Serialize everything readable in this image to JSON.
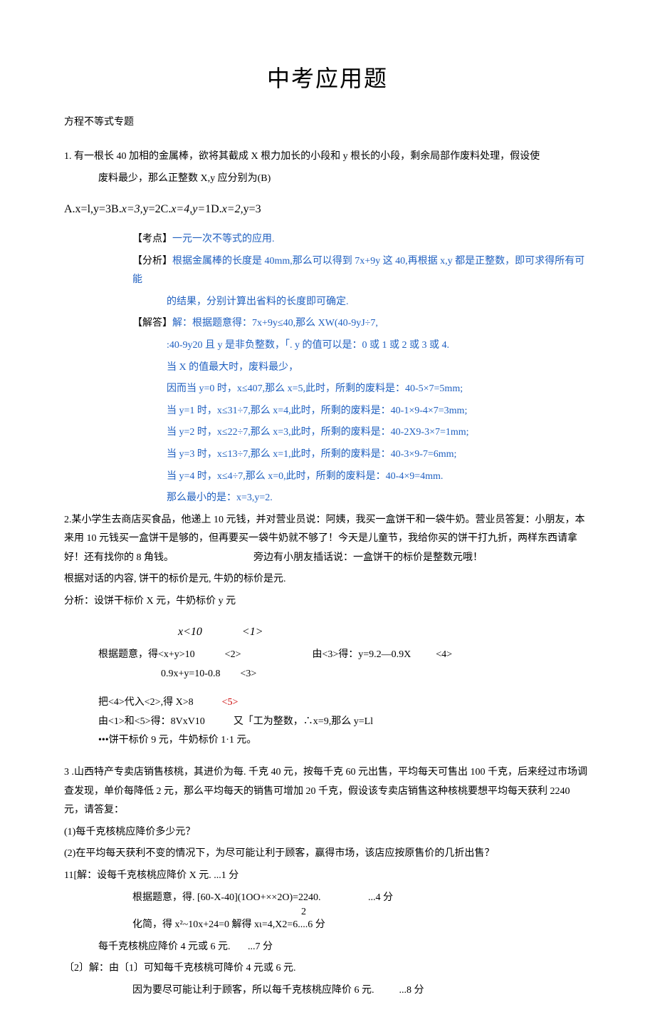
{
  "title": "中考应用题",
  "subtitle": "方程不等式专题",
  "q1": {
    "stem": "1. 有一根长 40 加相的金属棒，欲将其截成 X 根力加长的小段和 y 根长的小段，剩余局部作废料处理，假设使",
    "stem2": "废料最少，那么正整数 X,y 应分别为(B)",
    "opts": "A.x=l,y=3B.x=3,y=2C.x=4,y=1D.x=2,y=3",
    "kd_label": "【考点】",
    "kd_text": "一元一次不等式的应用.",
    "fx_label": "【分析】",
    "fx_text1": "根据金属棒的长度是 40mm,那么可以得到 7x+9y 这 40,再根据 x,y 都是正整数，即可求得所有可能",
    "fx_text2": "的结果，分别计算出省料的长度即可确定.",
    "jd_label": "【解答】",
    "jd_l1": "解：根据题意得：7x+9y≤40,那么 XW(40-9yJ÷7,",
    "jd_l2": ":40-9y20 且 y 是非负整数，「. y 的值可以是：0 或 1 或 2 或 3 或 4.",
    "jd_l3": "当 X 的值最大时，废料最少，",
    "jd_l4": "因而当 y=0 时，x≤407,那么 x=5,此时，所剩的废料是：40-5×7=5mm;",
    "jd_l5": "当 y=1 时，x≤31÷7,那么 x=4,此时，所剩的废料是：40-1×9-4×7=3mm;",
    "jd_l6": "当 y=2 时，x≤22÷7,那么 x=3,此时，所剩的废料是：40-2X9-3×7=1mm;",
    "jd_l7": "当 y=3 时，x≤13÷7,那么 x=1,此时，所剩的废料是：40-3×9-7=6mm;",
    "jd_l8": "当 y=4 时，x≤4÷7,那么 x=0,此时，所剩的废料是：40-4×9=4mm.",
    "jd_l9": "那么最小的是：x=3,y=2."
  },
  "q2": {
    "p1": "2.某小学生去商店买食品，他递上 10 元钱，并对营业员说：阿姨，我买一盒饼干和一袋牛奶。营业员答复：小朋友，本来用 10 元钱买一盒饼干是够的，但再要买一袋牛奶就不够了！今天是儿童节，我给你买的饼干打九折，两样东西请拿好！还有找你的 8 角钱。                                旁边有小朋友插话说：一盒饼干的标价是整数元哦！",
    "p2": "根据对话的内容, 饼干的标价是元, 牛奶的标价是元.",
    "p3": "分析：设饼干标价 X 元，牛奶标价 y 元",
    "e1": "x<10              <1>",
    "e2a": "根据题意，得<x+y>10            <2>",
    "e2b": "由<3>得：y=9.2—0.9X          <4>",
    "e3": "0.9x+y=10-0.8        <3>",
    "e4a": "把<4>代入<2>,得 X>8",
    "e4b": "<5>",
    "e5a": "由<1>和<5>得：8VxV10",
    "e5b": "又「工为整数，∴x=9,那么 y=Ll",
    "e6": "•••饼干标价 9 元，牛奶标价 1·1 元。"
  },
  "q3": {
    "p1": "3 .山西特产专卖店销售核桃，其进价为每. 千克 40 元，按每千克 60 元出售，平均每天可售出 100 千克，后来经过市场调查发现，单价每降低 2 元，那么平均每天的销售可增加 20 千克，假设该专卖店销售这种核桃要想平均每天获利 2240 元，请答复：",
    "p2": "(1)每千克核桃应降价多少元？",
    "p3": "(2)在平均每天获利不变的情况下，为尽可能让利于顾客，赢得市场，该店应按原售价的几折出售？",
    "p4": "11[解：设每千克核桃应降价 X 元. ...1 分",
    "p5": "根据题意，得. [60-X-40](1OO+××2O)=2240.                   ...4 分",
    "p5u": "2",
    "p6": "化简，得 x²~10x+24=0 解得 xι=4,X2=6....6 分",
    "p7": "每千克核桃应降价 4 元或 6 元.       ...7 分",
    "p8": "〔2〕解：由〔1〕可知每千克核桃可降价 4 元或 6 元.",
    "p9": "因为要尽可能让利于顾客，所以每千克核桃应降价 6 元.          ...8 分"
  }
}
